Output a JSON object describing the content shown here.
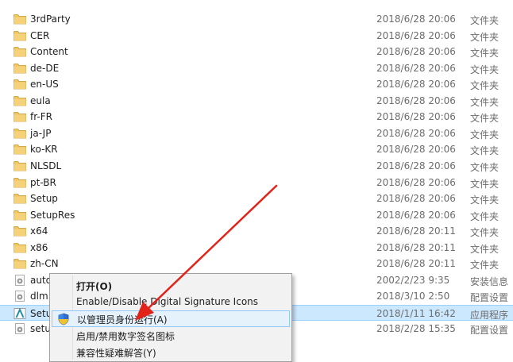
{
  "files": [
    {
      "name": "3rdParty",
      "date": "2018/6/28 20:06",
      "type": "文件夹",
      "icon": "folder-icon"
    },
    {
      "name": "CER",
      "date": "2018/6/28 20:06",
      "type": "文件夹",
      "icon": "folder-icon"
    },
    {
      "name": "Content",
      "date": "2018/6/28 20:06",
      "type": "文件夹",
      "icon": "folder-icon"
    },
    {
      "name": "de-DE",
      "date": "2018/6/28 20:06",
      "type": "文件夹",
      "icon": "folder-icon"
    },
    {
      "name": "en-US",
      "date": "2018/6/28 20:06",
      "type": "文件夹",
      "icon": "folder-icon"
    },
    {
      "name": "eula",
      "date": "2018/6/28 20:06",
      "type": "文件夹",
      "icon": "folder-icon"
    },
    {
      "name": "fr-FR",
      "date": "2018/6/28 20:06",
      "type": "文件夹",
      "icon": "folder-icon"
    },
    {
      "name": "ja-JP",
      "date": "2018/6/28 20:06",
      "type": "文件夹",
      "icon": "folder-icon"
    },
    {
      "name": "ko-KR",
      "date": "2018/6/28 20:06",
      "type": "文件夹",
      "icon": "folder-icon"
    },
    {
      "name": "NLSDL",
      "date": "2018/6/28 20:06",
      "type": "文件夹",
      "icon": "folder-icon"
    },
    {
      "name": "pt-BR",
      "date": "2018/6/28 20:06",
      "type": "文件夹",
      "icon": "folder-icon"
    },
    {
      "name": "Setup",
      "date": "2018/6/28 20:06",
      "type": "文件夹",
      "icon": "folder-icon"
    },
    {
      "name": "SetupRes",
      "date": "2018/6/28 20:06",
      "type": "文件夹",
      "icon": "folder-icon"
    },
    {
      "name": "x64",
      "date": "2018/6/28 20:11",
      "type": "文件夹",
      "icon": "folder-icon"
    },
    {
      "name": "x86",
      "date": "2018/6/28 20:11",
      "type": "文件夹",
      "icon": "folder-icon"
    },
    {
      "name": "zh-CN",
      "date": "2018/6/28 20:11",
      "type": "文件夹",
      "icon": "folder-icon"
    },
    {
      "name": "auto",
      "date": "2002/2/23 9:35",
      "type": "安装信息",
      "icon": "settings-file-icon"
    },
    {
      "name": "dlm.",
      "date": "2018/3/10 2:50",
      "type": "配置设置",
      "icon": "settings-file-icon"
    },
    {
      "name": "Setu",
      "date": "2018/1/11 16:42",
      "type": "应用程序",
      "icon": "autodesk-app-icon"
    },
    {
      "name": "setu",
      "date": "2018/2/28 15:35",
      "type": "配置设置",
      "icon": "settings-file-icon"
    }
  ],
  "context_menu": {
    "items": [
      {
        "label": "打开(O)",
        "bold": true
      },
      {
        "label": "Enable/Disable Digital Signature Icons"
      },
      {
        "label": "以管理员身份运行(A)",
        "icon": "uac-shield-icon"
      },
      {
        "label": "启用/禁用数字签名图标"
      },
      {
        "label": "兼容性疑难解答(Y)"
      }
    ]
  },
  "colors": {
    "folder": "#e8b44a",
    "selection": "#cce8ff",
    "arrow": "#e2231a",
    "menu_bg": "#f2f2f2"
  }
}
